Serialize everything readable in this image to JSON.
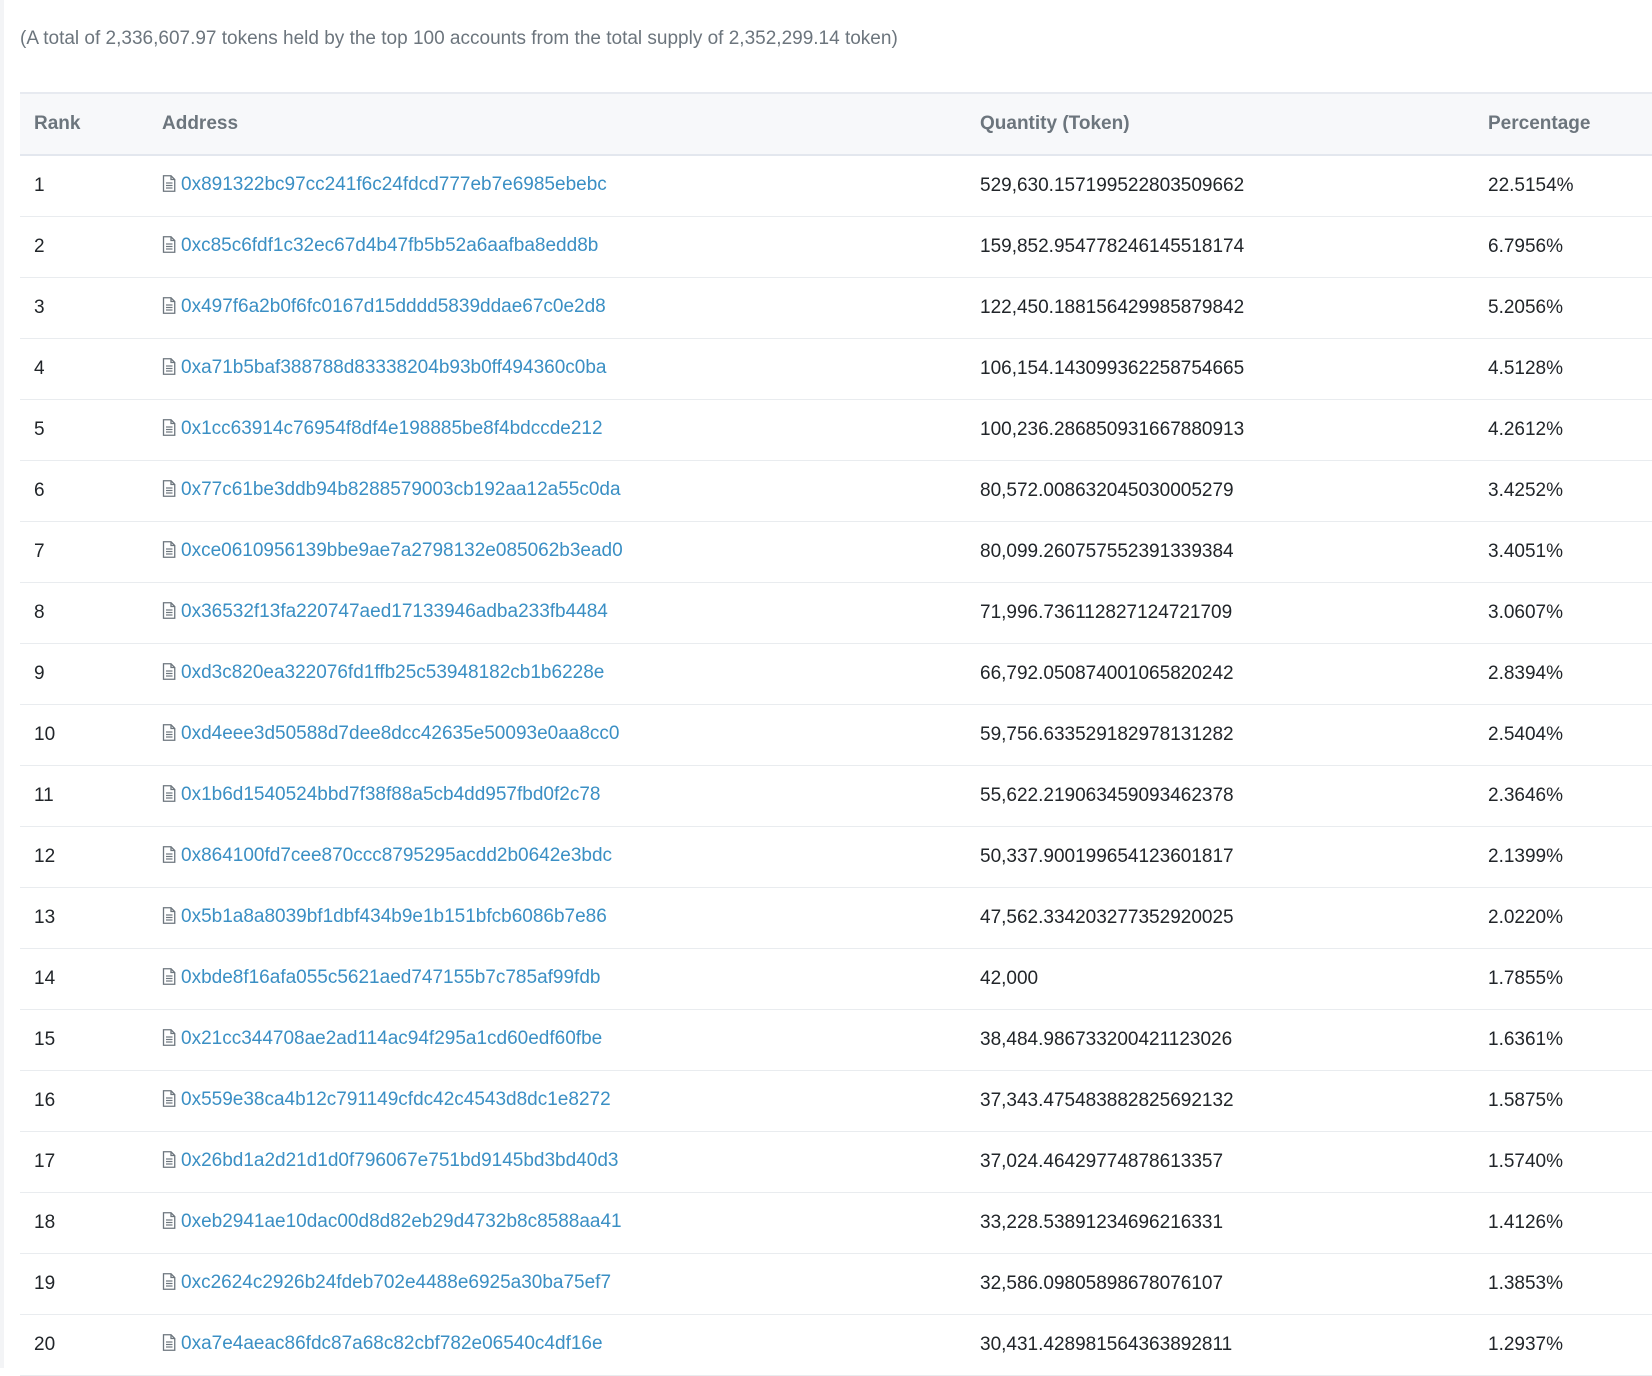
{
  "summary": "(A total of 2,336,607.97 tokens held by the top 100 accounts from the total supply of 2,352,299.14 token)",
  "table": {
    "headers": {
      "rank": "Rank",
      "address": "Address",
      "quantity": "Quantity (Token)",
      "percentage": "Percentage"
    },
    "rows": [
      {
        "rank": "1",
        "address": "0x891322bc97cc241f6c24fdcd777eb7e6985ebebc",
        "quantity": "529,630.157199522803509662",
        "percentage": "22.5154%",
        "contract": false
      },
      {
        "rank": "2",
        "address": "0xc85c6fdf1c32ec67d4b47fb5b52a6aafba8edd8b",
        "quantity": "159,852.954778246145518174",
        "percentage": "6.7956%",
        "contract": true
      },
      {
        "rank": "3",
        "address": "0x497f6a2b0f6fc0167d15dddd5839ddae67c0e2d8",
        "quantity": "122,450.188156429985879842",
        "percentage": "5.2056%",
        "contract": false
      },
      {
        "rank": "4",
        "address": "0xa71b5baf388788d83338204b93b0ff494360c0ba",
        "quantity": "106,154.143099362258754665",
        "percentage": "4.5128%",
        "contract": false
      },
      {
        "rank": "5",
        "address": "0x1cc63914c76954f8df4e198885be8f4bdccde212",
        "quantity": "100,236.286850931667880913",
        "percentage": "4.2612%",
        "contract": false
      },
      {
        "rank": "6",
        "address": "0x77c61be3ddb94b8288579003cb192aa12a55c0da",
        "quantity": "80,572.008632045030005279",
        "percentage": "3.4252%",
        "contract": false
      },
      {
        "rank": "7",
        "address": "0xce0610956139bbe9ae7a2798132e085062b3ead0",
        "quantity": "80,099.260757552391339384",
        "percentage": "3.4051%",
        "contract": false
      },
      {
        "rank": "8",
        "address": "0x36532f13fa220747aed17133946adba233fb4484",
        "quantity": "71,996.736112827124721709",
        "percentage": "3.0607%",
        "contract": false
      },
      {
        "rank": "9",
        "address": "0xd3c820ea322076fd1ffb25c53948182cb1b6228e",
        "quantity": "66,792.050874001065820242",
        "percentage": "2.8394%",
        "contract": false
      },
      {
        "rank": "10",
        "address": "0xd4eee3d50588d7dee8dcc42635e50093e0aa8cc0",
        "quantity": "59,756.633529182978131282",
        "percentage": "2.5404%",
        "contract": false
      },
      {
        "rank": "11",
        "address": "0x1b6d1540524bbd7f38f88a5cb4dd957fbd0f2c78",
        "quantity": "55,622.219063459093462378",
        "percentage": "2.3646%",
        "contract": false
      },
      {
        "rank": "12",
        "address": "0x864100fd7cee870ccc8795295acdd2b0642e3bdc",
        "quantity": "50,337.900199654123601817",
        "percentage": "2.1399%",
        "contract": false
      },
      {
        "rank": "13",
        "address": "0x5b1a8a8039bf1dbf434b9e1b151bfcb6086b7e86",
        "quantity": "47,562.334203277352920025",
        "percentage": "2.0220%",
        "contract": false
      },
      {
        "rank": "14",
        "address": "0xbde8f16afa055c5621aed747155b7c785af99fdb",
        "quantity": "42,000",
        "percentage": "1.7855%",
        "contract": false
      },
      {
        "rank": "15",
        "address": "0x21cc344708ae2ad114ac94f295a1cd60edf60fbe",
        "quantity": "38,484.986733200421123026",
        "percentage": "1.6361%",
        "contract": false
      },
      {
        "rank": "16",
        "address": "0x559e38ca4b12c791149cfdc42c4543d8dc1e8272",
        "quantity": "37,343.475483882825692132",
        "percentage": "1.5875%",
        "contract": false
      },
      {
        "rank": "17",
        "address": "0x26bd1a2d21d1d0f796067e751bd9145bd3bd40d3",
        "quantity": "37,024.46429774878613357",
        "percentage": "1.5740%",
        "contract": false
      },
      {
        "rank": "18",
        "address": "0xeb2941ae10dac00d8d82eb29d4732b8c8588aa41",
        "quantity": "33,228.53891234696216331",
        "percentage": "1.4126%",
        "contract": false
      },
      {
        "rank": "19",
        "address": "0xc2624c2926b24fdeb702e4488e6925a30ba75ef7",
        "quantity": "32,586.09805898678076107",
        "percentage": "1.3853%",
        "contract": false
      },
      {
        "rank": "20",
        "address": "0xa7e4aeac86fdc87a68c82cbf782e06540c4df16e",
        "quantity": "30,431.428981564363892811",
        "percentage": "1.2937%",
        "contract": false
      }
    ]
  },
  "colors": {
    "link": "#3a8fc4",
    "header_bg": "#f7f8fa",
    "muted_text": "#6c757d",
    "row_border": "#e9ecef"
  },
  "icons": {
    "contract": "file-text-icon"
  }
}
